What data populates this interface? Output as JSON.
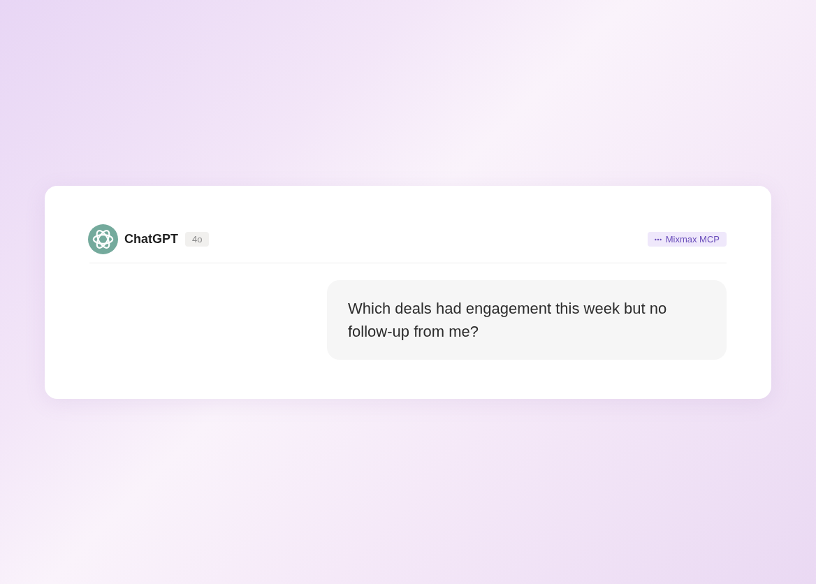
{
  "chat": {
    "assistant": {
      "name": "ChatGPT",
      "model": "4o"
    },
    "integration": {
      "label": "Mixmax MCP"
    },
    "messages": [
      {
        "kind": "user",
        "text": "Which deals had engagement this week but no follow-up from me?"
      }
    ]
  }
}
